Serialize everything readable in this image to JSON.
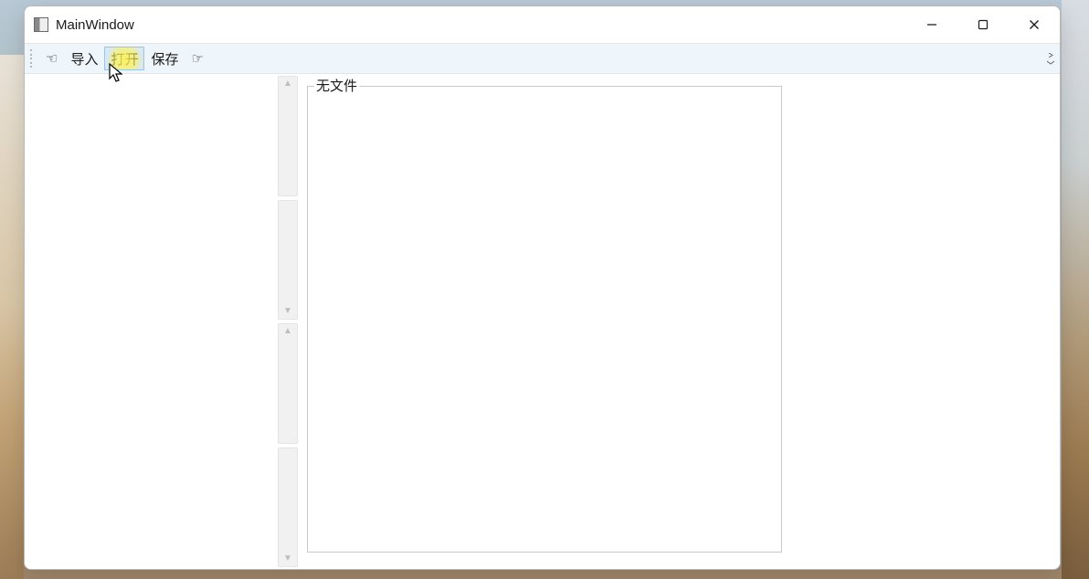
{
  "window": {
    "title": "MainWindow"
  },
  "toolbar": {
    "nav_back_glyph": "☜",
    "import_label": "导入",
    "open_label": "打开",
    "save_label": "保存",
    "nav_forward_glyph": "☞"
  },
  "content": {
    "groupbox_title": "无文件"
  }
}
